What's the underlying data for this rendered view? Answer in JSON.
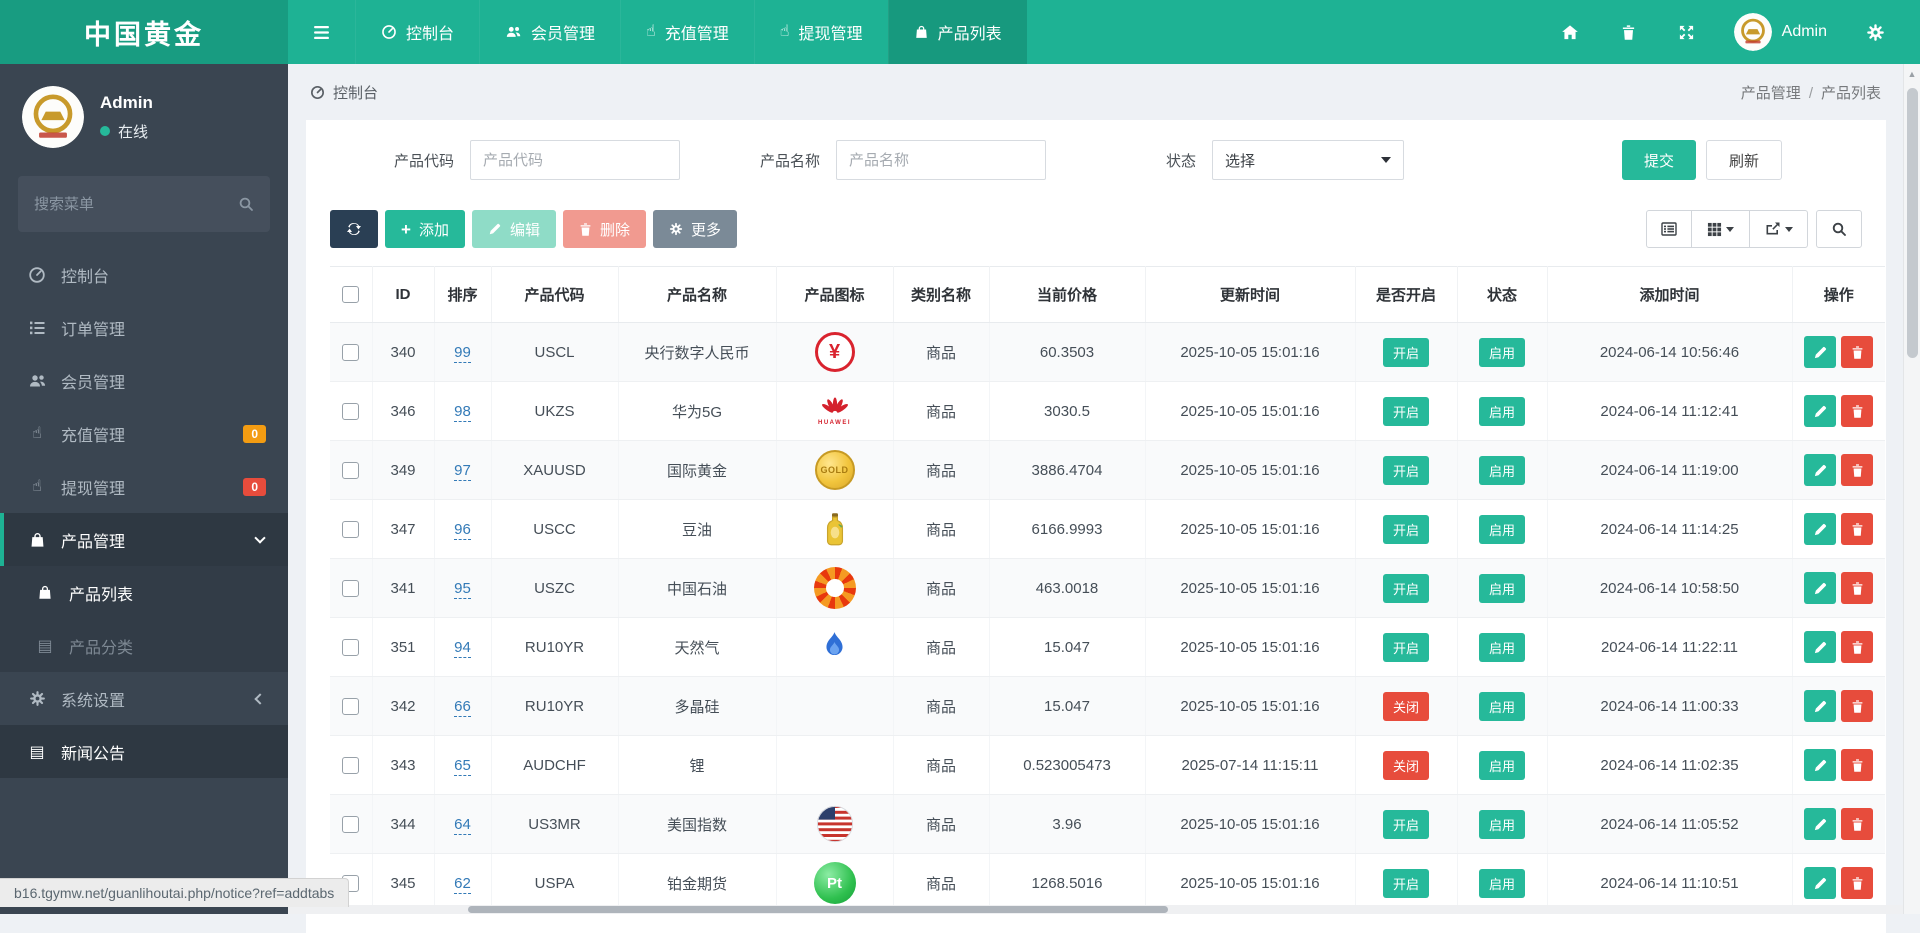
{
  "navbar": {
    "brand": "中国黄金",
    "items": [
      {
        "label": "控制台",
        "icon": "gauge-icon"
      },
      {
        "label": "会员管理",
        "icon": "users-icon"
      },
      {
        "label": "充值管理",
        "icon": "hand-up-icon"
      },
      {
        "label": "提现管理",
        "icon": "hand-up-icon"
      },
      {
        "label": "产品列表",
        "icon": "bag-icon",
        "active": true
      }
    ],
    "user": "Admin"
  },
  "sidebar": {
    "user": {
      "name": "Admin",
      "status": "在线"
    },
    "search_placeholder": "搜索菜单",
    "items": [
      {
        "label": "控制台",
        "icon": "gauge-icon"
      },
      {
        "label": "订单管理",
        "icon": "ordered-list-icon"
      },
      {
        "label": "会员管理",
        "icon": "users-icon"
      },
      {
        "label": "充值管理",
        "icon": "hand-up-icon",
        "badge": "0",
        "badge_color": "#f39c12"
      },
      {
        "label": "提现管理",
        "icon": "hand-up-icon",
        "badge": "0",
        "badge_color": "#e74c3c"
      },
      {
        "label": "产品管理",
        "icon": "bag-icon",
        "active": true,
        "expanded": true,
        "children": [
          {
            "label": "产品列表",
            "icon": "bag-icon",
            "active": true
          },
          {
            "label": "产品分类",
            "icon": "card-icon"
          }
        ]
      },
      {
        "label": "系统设置",
        "icon": "gears-icon",
        "collapsed": true
      },
      {
        "label": "新闻公告",
        "icon": "newspaper-icon",
        "highlighted": true
      }
    ]
  },
  "breadcrumb": {
    "left": "控制台",
    "right1": "产品管理",
    "sep": "/",
    "right2": "产品列表"
  },
  "filters": {
    "fields": [
      {
        "label": "产品代码",
        "placeholder": "产品代码",
        "type": "text"
      },
      {
        "label": "产品名称",
        "placeholder": "产品名称",
        "type": "text"
      },
      {
        "label": "状态",
        "value": "选择",
        "type": "select"
      }
    ],
    "submit_label": "提交",
    "refresh_label": "刷新"
  },
  "toolbar": {
    "add_label": "添加",
    "edit_label": "编辑",
    "delete_label": "删除",
    "more_label": "更多"
  },
  "table": {
    "columns": [
      "ID",
      "排序",
      "产品代码",
      "产品名称",
      "产品图标",
      "类别名称",
      "当前价格",
      "更新时间",
      "是否开启",
      "状态",
      "添加时间",
      "操作"
    ],
    "icon_texts": {
      "yuan": "¥",
      "huawei": "HUAWEI",
      "gold": "GOLD",
      "platinum": "Pt"
    },
    "rows": [
      {
        "id": "340",
        "sort": "99",
        "code": "USCL",
        "name": "央行数字人民币",
        "icon": "digital-yuan-emblem",
        "category": "商品",
        "price": "60.3503",
        "updated": "2025-10-05 15:01:16",
        "open_label": "开启",
        "open_on": true,
        "status_label": "启用",
        "added": "2024-06-14 10:56:46"
      },
      {
        "id": "346",
        "sort": "98",
        "code": "UKZS",
        "name": "华为5G",
        "icon": "huawei-logo",
        "category": "商品",
        "price": "3030.5",
        "updated": "2025-10-05 15:01:16",
        "open_label": "开启",
        "open_on": true,
        "status_label": "启用",
        "added": "2024-06-14 11:12:41"
      },
      {
        "id": "349",
        "sort": "97",
        "code": "XAUUSD",
        "name": "国际黄金",
        "icon": "gold-coin",
        "category": "商品",
        "price": "3886.4704",
        "updated": "2025-10-05 15:01:16",
        "open_label": "开启",
        "open_on": true,
        "status_label": "启用",
        "added": "2024-06-14 11:19:00"
      },
      {
        "id": "347",
        "sort": "96",
        "code": "USCC",
        "name": "豆油",
        "icon": "oil-bottle",
        "category": "商品",
        "price": "6166.9993",
        "updated": "2025-10-05 15:01:16",
        "open_label": "开启",
        "open_on": true,
        "status_label": "启用",
        "added": "2024-06-14 11:14:25"
      },
      {
        "id": "341",
        "sort": "95",
        "code": "USZC",
        "name": "中国石油",
        "icon": "petrochina-logo",
        "category": "商品",
        "price": "463.0018",
        "updated": "2025-10-05 15:01:16",
        "open_label": "开启",
        "open_on": true,
        "status_label": "启用",
        "added": "2024-06-14 10:58:50"
      },
      {
        "id": "351",
        "sort": "94",
        "code": "RU10YR",
        "name": "天然气",
        "icon": "gas-flame",
        "category": "商品",
        "price": "15.047",
        "updated": "2025-10-05 15:01:16",
        "open_label": "开启",
        "open_on": true,
        "status_label": "启用",
        "added": "2024-06-14 11:22:11"
      },
      {
        "id": "342",
        "sort": "66",
        "code": "RU10YR",
        "name": "多晶硅",
        "icon": "none",
        "category": "商品",
        "price": "15.047",
        "updated": "2025-10-05 15:01:16",
        "open_label": "关闭",
        "open_on": false,
        "status_label": "启用",
        "added": "2024-06-14 11:00:33"
      },
      {
        "id": "343",
        "sort": "65",
        "code": "AUDCHF",
        "name": "锂",
        "icon": "none",
        "category": "商品",
        "price": "0.523005473",
        "updated": "2025-07-14 11:15:11",
        "open_label": "关闭",
        "open_on": false,
        "status_label": "启用",
        "added": "2024-06-14 11:02:35"
      },
      {
        "id": "344",
        "sort": "64",
        "code": "US3MR",
        "name": "美国指数",
        "icon": "us-flag",
        "category": "商品",
        "price": "3.96",
        "updated": "2025-10-05 15:01:16",
        "open_label": "开启",
        "open_on": true,
        "status_label": "启用",
        "added": "2024-06-14 11:05:52"
      },
      {
        "id": "345",
        "sort": "62",
        "code": "USPA",
        "name": "铂金期货",
        "icon": "platinum-sphere",
        "category": "商品",
        "price": "1268.5016",
        "updated": "2025-10-05 15:01:16",
        "open_label": "开启",
        "open_on": true,
        "status_label": "启用",
        "added": "2024-06-14 11:10:51"
      }
    ]
  },
  "statusbar": {
    "url": "b16.tgymw.net/guanlihoutai.php/notice?ref=addtabs"
  },
  "colors": {
    "navbar": "#1eb294",
    "sidebar": "#3a4551",
    "accent_green": "#26b99a",
    "danger_red": "#e74c3c",
    "warn_orange": "#f39c12",
    "dark_button": "#2a3f54",
    "link_blue": "#337ab7"
  }
}
